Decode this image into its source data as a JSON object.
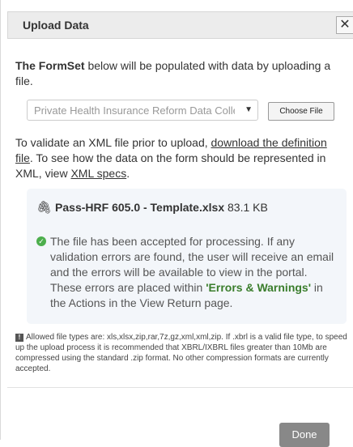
{
  "dialog": {
    "title": "Upload Data",
    "close_label": "✕"
  },
  "intro": {
    "bold": "The FormSet",
    "rest": " below will be populated with data by uploading a file."
  },
  "form_select": {
    "value": "Private Health Insurance Reform Data Collection"
  },
  "choose_file": {
    "label": "Choose File"
  },
  "validate": {
    "part1": "To validate an XML file prior to upload, ",
    "link1": "download the definition file",
    "part2": ". To see how the data on the form should be represented in XML, view ",
    "link2": "XML specs",
    "part3": "."
  },
  "upload_result": {
    "file_name": "Pass-HRF 605.0 - Template.xlsx",
    "file_size": "83.1 KB",
    "message_part1": "The file has been accepted for processing. If any validation errors are found, the user will receive an email and the errors will be available to view in the portal. These errors are placed within ",
    "message_highlight": "'Errors & Warnings'",
    "message_part2": " in the Actions in the View Return page."
  },
  "notice": {
    "text": "Allowed file types are: xls,xlsx,zip,rar,7z,gz,xml,xml,zip. If .xbrl is a valid file type, to speed up the upload process it is recommended that XBRL/IXBRL files greater than 10Mb are compressed using the standard .zip format. No other compression formats are currently accepted."
  },
  "footer": {
    "done_label": "Done"
  }
}
